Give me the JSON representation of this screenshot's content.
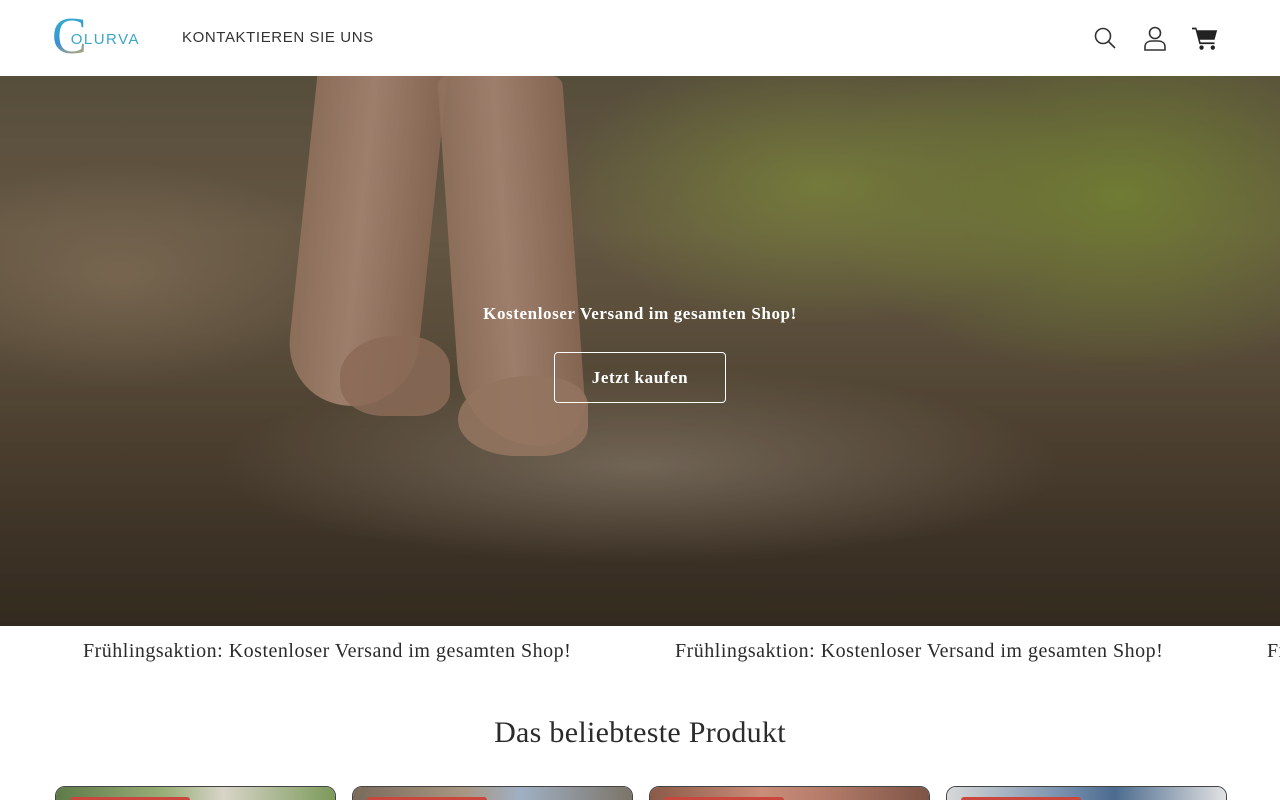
{
  "header": {
    "logo_mark": "C",
    "logo_text": "OLURVA",
    "nav_link": "KONTAKTIEREN SIE UNS",
    "icons": [
      "search-icon",
      "account-icon",
      "cart-icon"
    ]
  },
  "hero": {
    "text": "Kostenloser Versand im gesamten Shop!",
    "button_label": "Jetzt kaufen"
  },
  "announcement": {
    "items": [
      "Frühlingsaktion: Kostenloser Versand im gesamten Shop!",
      "Frühlingsaktion: Kostenloser Versand im gesamten Shop!",
      "Frühlingsaktion: Kostenloser Versand im gesamten Shop!"
    ]
  },
  "section": {
    "title": "Das beliebteste Produkt"
  },
  "products": {
    "count_visible": 4,
    "badge_color": "#c9473c"
  },
  "colors": {
    "text": "#2b2b2b",
    "logo_accent": "#3aa6c8",
    "badge": "#c9473c"
  }
}
